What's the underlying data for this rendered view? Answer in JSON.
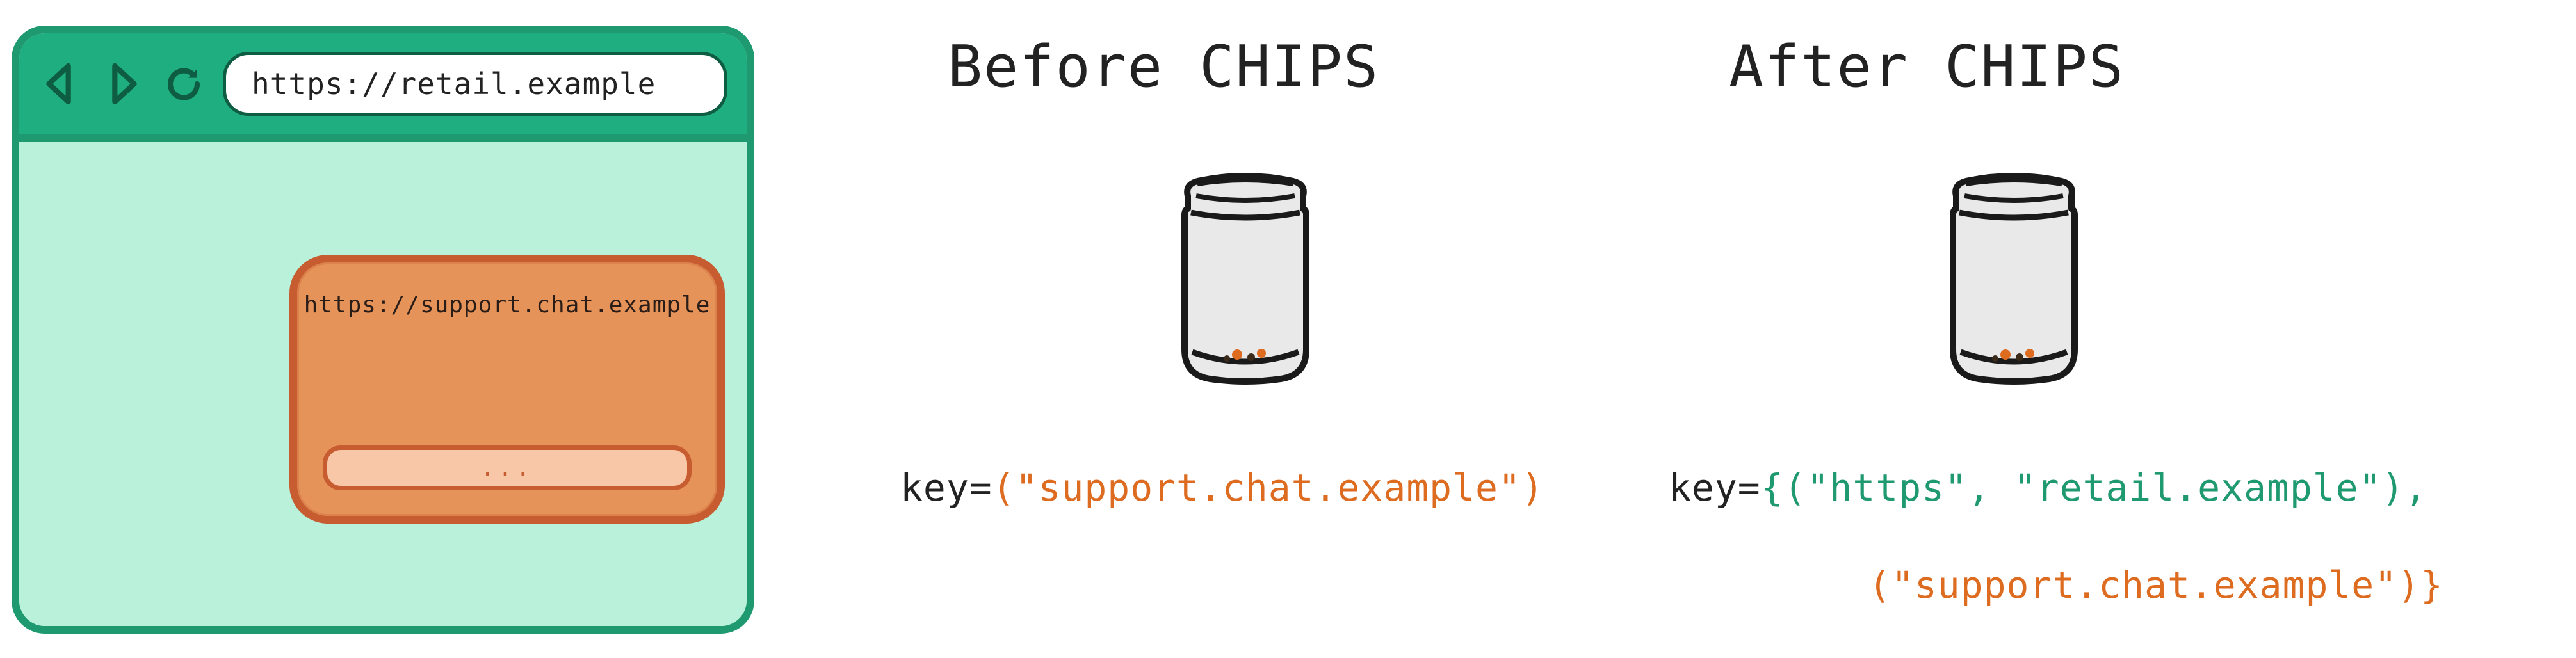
{
  "browser": {
    "top_site_url": "https://retail.example",
    "embedded_site_url": "https://support.chat.example",
    "chat_input_placeholder": "..."
  },
  "headings": {
    "before": "Before CHIPS",
    "after": "After CHIPS"
  },
  "before_key": {
    "prefix": "key=",
    "paren_open": "(",
    "value": "\"support.chat.example\"",
    "paren_close": ")"
  },
  "after_key_line1": {
    "prefix": "key=",
    "brace_open": "{(",
    "scheme": "\"https\"",
    "sep": ", ",
    "top_site": "\"retail.example\"",
    "close_comma": "),"
  },
  "after_key_line2": {
    "paren_open": "(",
    "value": "\"support.chat.example\"",
    "close": ")}"
  },
  "icons": {
    "back": "back-icon",
    "forward": "forward-icon",
    "reload": "reload-icon",
    "jar": "cookie-jar-icon"
  }
}
